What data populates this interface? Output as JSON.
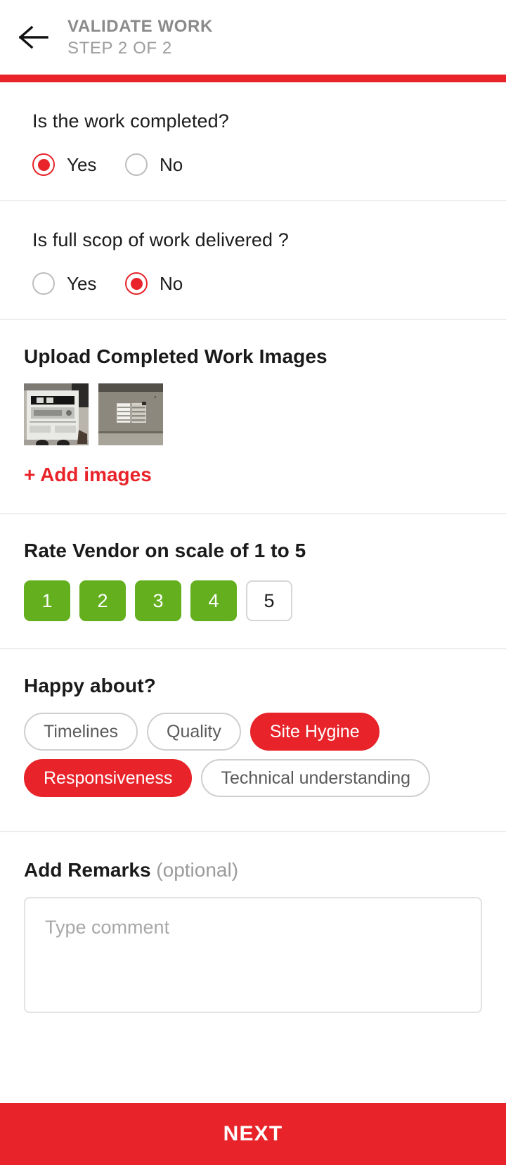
{
  "header": {
    "back_icon": "arrow-left-icon",
    "title": "VALIDATE WORK",
    "subtitle": "STEP 2 OF 2",
    "accent_color": "#e8232a"
  },
  "questions": [
    {
      "text": "Is the work completed?",
      "options": [
        {
          "label": "Yes",
          "selected": true
        },
        {
          "label": "No",
          "selected": false
        }
      ]
    },
    {
      "text": "Is full scop of work delivered ?",
      "options": [
        {
          "label": "Yes",
          "selected": false
        },
        {
          "label": "No",
          "selected": true
        }
      ]
    }
  ],
  "upload": {
    "title": "Upload Completed Work Images",
    "thumbnails": [
      {
        "alt": "floor-plan-drawing-photo"
      },
      {
        "alt": "window-grille-room-photo"
      }
    ],
    "add_label": "+ Add images",
    "add_color": "#e8232a"
  },
  "rating": {
    "title": "Rate Vendor on scale of 1 to 5",
    "scale": [
      "1",
      "2",
      "3",
      "4",
      "5"
    ],
    "selected_value": 4,
    "selected_color": "#63af1e"
  },
  "happy_about": {
    "title": "Happy about?",
    "tags": [
      {
        "label": "Timelines",
        "selected": false
      },
      {
        "label": "Quality",
        "selected": false
      },
      {
        "label": "Site Hygine",
        "selected": true
      },
      {
        "label": "Responsiveness",
        "selected": true
      },
      {
        "label": "Technical understanding",
        "selected": false
      }
    ],
    "selected_color": "#e8232a"
  },
  "remarks": {
    "label": "Add Remarks",
    "optional_label": "(optional)",
    "placeholder": "Type comment",
    "value": ""
  },
  "footer": {
    "next_label": "NEXT",
    "color": "#e8232a"
  }
}
